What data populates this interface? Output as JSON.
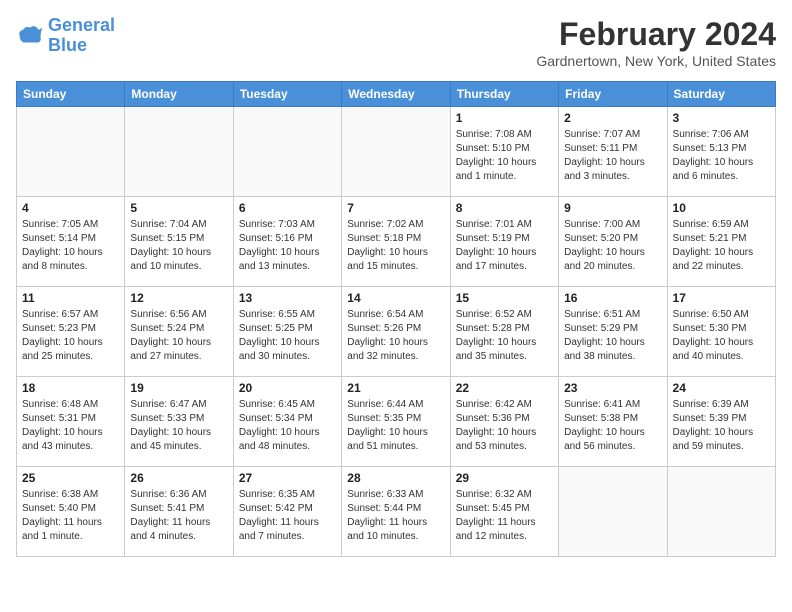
{
  "header": {
    "logo_line1": "General",
    "logo_line2": "Blue",
    "month_year": "February 2024",
    "location": "Gardnertown, New York, United States"
  },
  "weekdays": [
    "Sunday",
    "Monday",
    "Tuesday",
    "Wednesday",
    "Thursday",
    "Friday",
    "Saturday"
  ],
  "weeks": [
    [
      {
        "day": "",
        "info": ""
      },
      {
        "day": "",
        "info": ""
      },
      {
        "day": "",
        "info": ""
      },
      {
        "day": "",
        "info": ""
      },
      {
        "day": "1",
        "info": "Sunrise: 7:08 AM\nSunset: 5:10 PM\nDaylight: 10 hours\nand 1 minute."
      },
      {
        "day": "2",
        "info": "Sunrise: 7:07 AM\nSunset: 5:11 PM\nDaylight: 10 hours\nand 3 minutes."
      },
      {
        "day": "3",
        "info": "Sunrise: 7:06 AM\nSunset: 5:13 PM\nDaylight: 10 hours\nand 6 minutes."
      }
    ],
    [
      {
        "day": "4",
        "info": "Sunrise: 7:05 AM\nSunset: 5:14 PM\nDaylight: 10 hours\nand 8 minutes."
      },
      {
        "day": "5",
        "info": "Sunrise: 7:04 AM\nSunset: 5:15 PM\nDaylight: 10 hours\nand 10 minutes."
      },
      {
        "day": "6",
        "info": "Sunrise: 7:03 AM\nSunset: 5:16 PM\nDaylight: 10 hours\nand 13 minutes."
      },
      {
        "day": "7",
        "info": "Sunrise: 7:02 AM\nSunset: 5:18 PM\nDaylight: 10 hours\nand 15 minutes."
      },
      {
        "day": "8",
        "info": "Sunrise: 7:01 AM\nSunset: 5:19 PM\nDaylight: 10 hours\nand 17 minutes."
      },
      {
        "day": "9",
        "info": "Sunrise: 7:00 AM\nSunset: 5:20 PM\nDaylight: 10 hours\nand 20 minutes."
      },
      {
        "day": "10",
        "info": "Sunrise: 6:59 AM\nSunset: 5:21 PM\nDaylight: 10 hours\nand 22 minutes."
      }
    ],
    [
      {
        "day": "11",
        "info": "Sunrise: 6:57 AM\nSunset: 5:23 PM\nDaylight: 10 hours\nand 25 minutes."
      },
      {
        "day": "12",
        "info": "Sunrise: 6:56 AM\nSunset: 5:24 PM\nDaylight: 10 hours\nand 27 minutes."
      },
      {
        "day": "13",
        "info": "Sunrise: 6:55 AM\nSunset: 5:25 PM\nDaylight: 10 hours\nand 30 minutes."
      },
      {
        "day": "14",
        "info": "Sunrise: 6:54 AM\nSunset: 5:26 PM\nDaylight: 10 hours\nand 32 minutes."
      },
      {
        "day": "15",
        "info": "Sunrise: 6:52 AM\nSunset: 5:28 PM\nDaylight: 10 hours\nand 35 minutes."
      },
      {
        "day": "16",
        "info": "Sunrise: 6:51 AM\nSunset: 5:29 PM\nDaylight: 10 hours\nand 38 minutes."
      },
      {
        "day": "17",
        "info": "Sunrise: 6:50 AM\nSunset: 5:30 PM\nDaylight: 10 hours\nand 40 minutes."
      }
    ],
    [
      {
        "day": "18",
        "info": "Sunrise: 6:48 AM\nSunset: 5:31 PM\nDaylight: 10 hours\nand 43 minutes."
      },
      {
        "day": "19",
        "info": "Sunrise: 6:47 AM\nSunset: 5:33 PM\nDaylight: 10 hours\nand 45 minutes."
      },
      {
        "day": "20",
        "info": "Sunrise: 6:45 AM\nSunset: 5:34 PM\nDaylight: 10 hours\nand 48 minutes."
      },
      {
        "day": "21",
        "info": "Sunrise: 6:44 AM\nSunset: 5:35 PM\nDaylight: 10 hours\nand 51 minutes."
      },
      {
        "day": "22",
        "info": "Sunrise: 6:42 AM\nSunset: 5:36 PM\nDaylight: 10 hours\nand 53 minutes."
      },
      {
        "day": "23",
        "info": "Sunrise: 6:41 AM\nSunset: 5:38 PM\nDaylight: 10 hours\nand 56 minutes."
      },
      {
        "day": "24",
        "info": "Sunrise: 6:39 AM\nSunset: 5:39 PM\nDaylight: 10 hours\nand 59 minutes."
      }
    ],
    [
      {
        "day": "25",
        "info": "Sunrise: 6:38 AM\nSunset: 5:40 PM\nDaylight: 11 hours\nand 1 minute."
      },
      {
        "day": "26",
        "info": "Sunrise: 6:36 AM\nSunset: 5:41 PM\nDaylight: 11 hours\nand 4 minutes."
      },
      {
        "day": "27",
        "info": "Sunrise: 6:35 AM\nSunset: 5:42 PM\nDaylight: 11 hours\nand 7 minutes."
      },
      {
        "day": "28",
        "info": "Sunrise: 6:33 AM\nSunset: 5:44 PM\nDaylight: 11 hours\nand 10 minutes."
      },
      {
        "day": "29",
        "info": "Sunrise: 6:32 AM\nSunset: 5:45 PM\nDaylight: 11 hours\nand 12 minutes."
      },
      {
        "day": "",
        "info": ""
      },
      {
        "day": "",
        "info": ""
      }
    ]
  ]
}
